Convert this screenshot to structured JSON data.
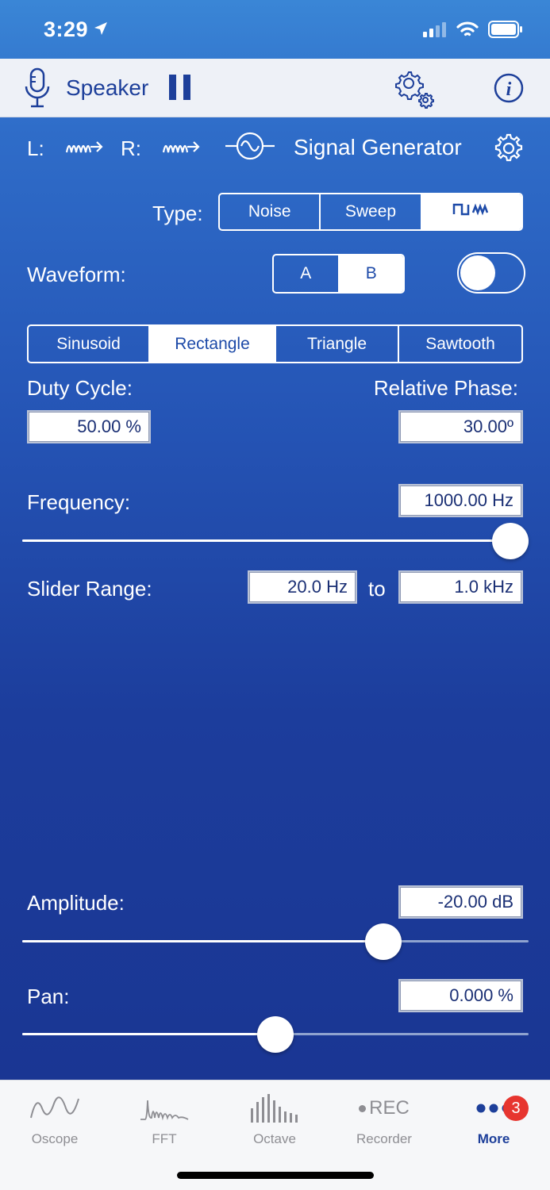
{
  "status_bar": {
    "time": "3:29"
  },
  "header": {
    "mic_label": "Speaker"
  },
  "channel_row": {
    "left_label": "L:",
    "right_label": "R:",
    "title": "Signal Generator"
  },
  "type_control": {
    "label": "Type:",
    "options": [
      "Noise",
      "Sweep",
      "pulse-wave-icon"
    ],
    "selected": 2
  },
  "waveform_control": {
    "label": "Waveform:",
    "options": [
      "A",
      "B"
    ],
    "selected": 1,
    "toggle_on": false
  },
  "shape_control": {
    "options": [
      "Sinusoid",
      "Rectangle",
      "Triangle",
      "Sawtooth"
    ],
    "selected": 1
  },
  "duty_cycle": {
    "label": "Duty Cycle:",
    "value": "50.00 %"
  },
  "relative_phase": {
    "label": "Relative Phase:",
    "value": "30.00º"
  },
  "frequency": {
    "label": "Frequency:",
    "value": "1000.00 Hz",
    "slider_fraction": 1.0
  },
  "slider_range": {
    "label": "Slider Range:",
    "min": "20.0 Hz",
    "to": "to",
    "max": "1.0 kHz"
  },
  "amplitude": {
    "label": "Amplitude:",
    "value": "-20.00 dB",
    "slider_fraction": 0.73
  },
  "pan": {
    "label": "Pan:",
    "value": "0.000 %",
    "slider_fraction": 0.5
  },
  "tabbar": {
    "tabs": [
      {
        "label": "Oscope",
        "icon": "oscope-icon"
      },
      {
        "label": "FFT",
        "icon": "fft-icon"
      },
      {
        "label": "Octave",
        "icon": "octave-icon"
      },
      {
        "label": "Recorder",
        "icon": "rec-icon",
        "icon_text": "REC"
      },
      {
        "label": "More",
        "icon": "more-icon",
        "badge": "3"
      }
    ],
    "active": 4
  },
  "colors": {
    "accent": "#1d3f9a",
    "badge": "#e7352f",
    "header_bg": "#eef1f7"
  }
}
